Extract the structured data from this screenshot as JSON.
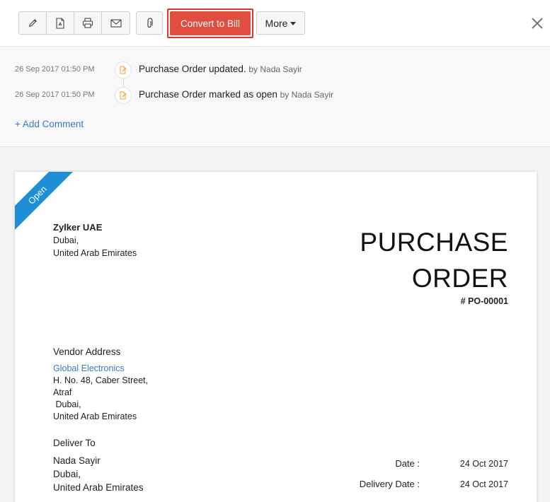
{
  "toolbar": {
    "convert_label": "Convert to Bill",
    "more_label": "More",
    "icons": [
      "pencil-icon",
      "pdf-icon",
      "printer-icon",
      "mail-icon",
      "paperclip-icon",
      "close-icon"
    ]
  },
  "activity": {
    "items": [
      {
        "time": "26 Sep 2017 01:50 PM",
        "text": "Purchase Order updated.",
        "by": "by Nada Sayir"
      },
      {
        "time": "26 Sep 2017 01:50 PM",
        "text": "Purchase Order marked as open",
        "by": "by Nada Sayir"
      }
    ],
    "add_comment": "+ Add Comment"
  },
  "document": {
    "status": "Open",
    "company": {
      "name": "Zylker UAE",
      "line1": "Dubai,",
      "line2": "United Arab Emirates"
    },
    "title_line1": "PURCHASE",
    "title_line2": "ORDER",
    "number": "# PO-00001",
    "vendor_label": "Vendor Address",
    "vendor": {
      "name": "Global Electronics",
      "line1": "H. No. 48, Caber Street,",
      "line2": "Atraf",
      "line3": " Dubai,",
      "line4": "United Arab Emirates"
    },
    "deliver_label": "Deliver To",
    "deliver": {
      "name": "Nada Sayir",
      "line1": "Dubai,",
      "line2": "United Arab Emirates"
    },
    "date_label": "Date :",
    "date_value": "24 Oct 2017",
    "delivery_date_label": "Delivery Date :",
    "delivery_date_value": "24 Oct 2017"
  },
  "colors": {
    "accent_red": "#e14d3f",
    "highlight_border": "#e0352b",
    "link_blue": "#3a78c4",
    "ribbon_blue": "#1e8fd6",
    "activity_icon": "#f0a030"
  }
}
